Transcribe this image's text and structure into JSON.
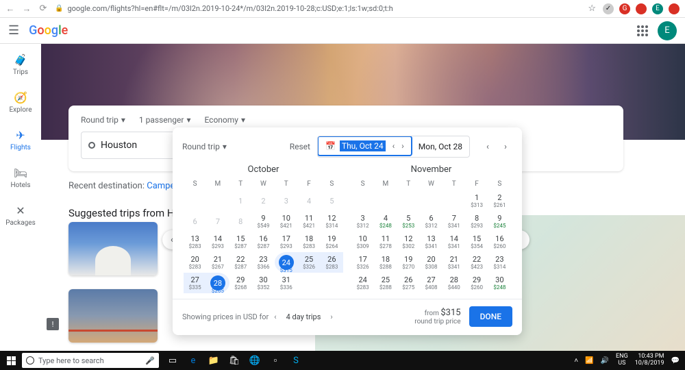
{
  "browser": {
    "url": "google.com/flights?hl=en#flt=/m/03l2n.2019-10-24*/m/03l2n.2019-10-28;c:USD;e:1;ls:1w;sd:0;t:h"
  },
  "header": {
    "avatar": "E"
  },
  "sidenav": {
    "items": [
      {
        "icon": "🧳",
        "label": "Trips"
      },
      {
        "icon": "🧭",
        "label": "Explore"
      },
      {
        "icon": "✈",
        "label": "Flights",
        "active": true
      },
      {
        "icon": "🛏",
        "label": "Hotels"
      },
      {
        "icon": "✕",
        "label": "Packages"
      }
    ]
  },
  "search": {
    "trip_type": "Round trip",
    "passengers": "1 passenger",
    "cabin": "Economy",
    "origin": "Houston"
  },
  "suggest": {
    "label": "Recent destination:",
    "link": "Campeche (C"
  },
  "suggest2": "Suggested trips from Houston",
  "datepicker": {
    "trip_type": "Round trip",
    "reset": "Reset",
    "depart": "Thu, Oct 24",
    "return": "Mon, Oct 28",
    "months": [
      {
        "name": "October",
        "offset": 2,
        "days": [
          {
            "n": 1,
            "d": true
          },
          {
            "n": 2,
            "d": true
          },
          {
            "n": 3,
            "d": true
          },
          {
            "n": 4,
            "d": true
          },
          {
            "n": 5,
            "d": true
          },
          {
            "n": 6,
            "d": true
          },
          {
            "n": 7,
            "d": true
          },
          {
            "n": 8,
            "d": true
          },
          {
            "n": 9,
            "p": "$549"
          },
          {
            "n": 10,
            "p": "$421"
          },
          {
            "n": 11,
            "p": "$421"
          },
          {
            "n": 12,
            "p": "$314"
          },
          {
            "n": 13,
            "p": "$283"
          },
          {
            "n": 14,
            "p": "$293"
          },
          {
            "n": 15,
            "p": "$287"
          },
          {
            "n": 16,
            "p": "$287"
          },
          {
            "n": 17,
            "p": "$293"
          },
          {
            "n": 18,
            "p": "$283"
          },
          {
            "n": 19,
            "p": "$264"
          },
          {
            "n": 20,
            "p": "$283"
          },
          {
            "n": 21,
            "p": "$267"
          },
          {
            "n": 22,
            "p": "$287"
          },
          {
            "n": 23,
            "p": "$366"
          },
          {
            "n": 24,
            "p": "$315",
            "start": true
          },
          {
            "n": 25,
            "p": "$326",
            "range": true
          },
          {
            "n": 26,
            "p": "$283",
            "range": true
          },
          {
            "n": 27,
            "p": "$335",
            "range": true
          },
          {
            "n": 28,
            "p": "$265",
            "end": true
          },
          {
            "n": 29,
            "p": "$268"
          },
          {
            "n": 30,
            "p": "$352"
          },
          {
            "n": 31,
            "p": "$336"
          }
        ]
      },
      {
        "name": "November",
        "offset": 5,
        "days": [
          {
            "n": 1,
            "p": "$313"
          },
          {
            "n": 2,
            "p": "$261"
          },
          {
            "n": 3,
            "p": "$312"
          },
          {
            "n": 4,
            "p": "$248",
            "g": true
          },
          {
            "n": 5,
            "p": "$253",
            "g": true
          },
          {
            "n": 6,
            "p": "$312"
          },
          {
            "n": 7,
            "p": "$341"
          },
          {
            "n": 8,
            "p": "$293"
          },
          {
            "n": 9,
            "p": "$245",
            "g": true
          },
          {
            "n": 10,
            "p": "$309"
          },
          {
            "n": 11,
            "p": "$278"
          },
          {
            "n": 12,
            "p": "$302"
          },
          {
            "n": 13,
            "p": "$341"
          },
          {
            "n": 14,
            "p": "$341"
          },
          {
            "n": 15,
            "p": "$354"
          },
          {
            "n": 16,
            "p": "$260"
          },
          {
            "n": 17,
            "p": "$326"
          },
          {
            "n": 18,
            "p": "$288"
          },
          {
            "n": 19,
            "p": "$270"
          },
          {
            "n": 20,
            "p": "$308"
          },
          {
            "n": 21,
            "p": "$341"
          },
          {
            "n": 22,
            "p": "$423"
          },
          {
            "n": 23,
            "p": "$314"
          },
          {
            "n": 24,
            "p": "$283"
          },
          {
            "n": 25,
            "p": "$288"
          },
          {
            "n": 26,
            "p": "$275"
          },
          {
            "n": 27,
            "p": "$408"
          },
          {
            "n": 28,
            "p": "$440"
          },
          {
            "n": 29,
            "p": "$260"
          },
          {
            "n": 30,
            "p": "$248",
            "g": true
          }
        ]
      }
    ],
    "footer": {
      "info": "Showing prices in USD for",
      "duration": "4 day trips",
      "from": "from",
      "amount": "$315",
      "sub": "round trip price",
      "done": "DONE"
    }
  },
  "taskbar": {
    "search_ph": "Type here to search",
    "lang": "ENG",
    "region": "US",
    "time": "10:43 PM",
    "date": "10/8/2019"
  }
}
